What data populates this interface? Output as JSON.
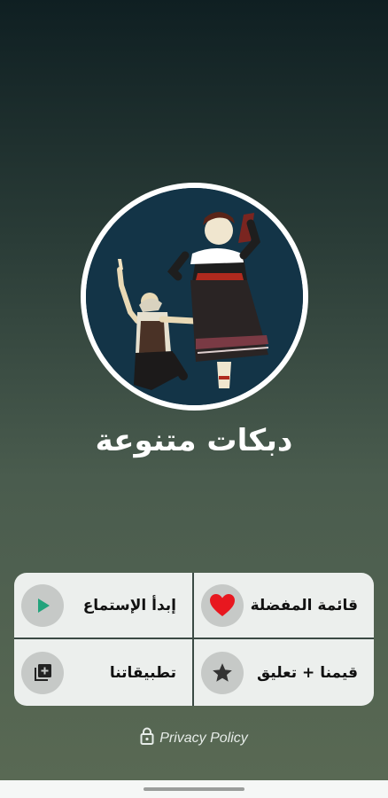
{
  "app": {
    "title": "دبكات متنوعة"
  },
  "menu": {
    "items": [
      {
        "key": "favorites",
        "label": "قائمة المفضلة",
        "icon": "heart-icon"
      },
      {
        "key": "start",
        "label": "إبدأ الإستماع",
        "icon": "play-icon"
      },
      {
        "key": "rate",
        "label": "قيمنا + تعليق",
        "icon": "star-icon"
      },
      {
        "key": "apps",
        "label": "تطبيقاتنا",
        "icon": "add-library-icon"
      }
    ]
  },
  "footer": {
    "privacy_label": "Privacy Policy",
    "privacy_icon": "lock-icon"
  },
  "colors": {
    "heart": "#e8171f",
    "play": "#22a37c",
    "card_bg": "#ecefed",
    "avatar_bg": "#133447"
  }
}
